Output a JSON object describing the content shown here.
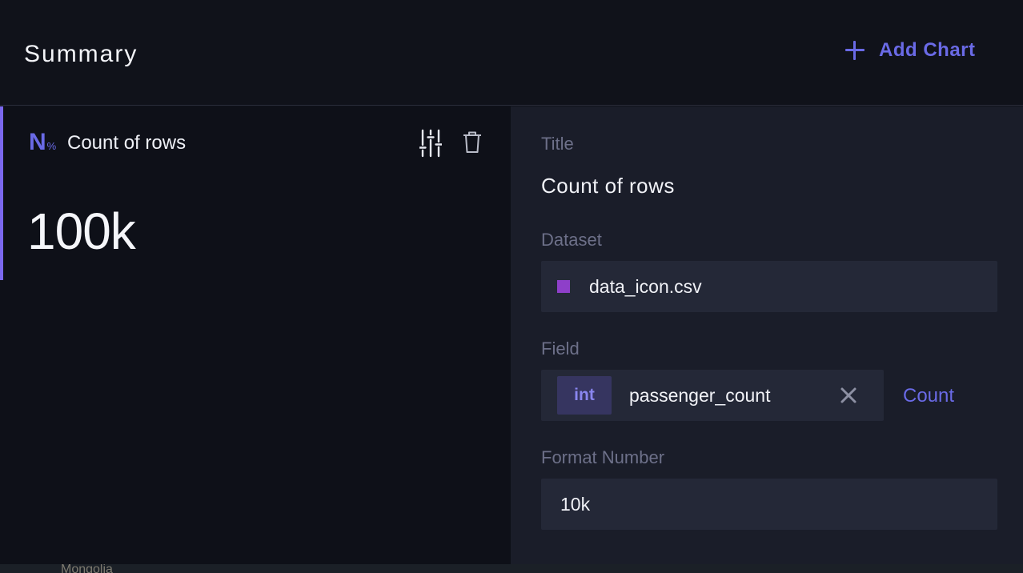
{
  "header": {
    "title": "Summary",
    "add_chart_label": "Add Chart",
    "add_chart_icon": "plus-icon"
  },
  "card": {
    "type_icon": {
      "letter": "N",
      "suffix": "%"
    },
    "title": "Count of rows",
    "value": "100k",
    "settings_icon": "sliders-icon",
    "delete_icon": "trash-icon",
    "accent_color": "#7b68ee"
  },
  "editor": {
    "title_label": "Title",
    "title_value": "Count of rows",
    "dataset_label": "Dataset",
    "dataset_name": "data_icon.csv",
    "dataset_color": "#8e3fc9",
    "field_label": "Field",
    "field_type": "int",
    "field_name": "passenger_count",
    "field_clear_icon": "close-icon",
    "aggregation": "Count",
    "format_label": "Format Number",
    "format_value": "10k"
  },
  "background": {
    "partial_text": "Mongolia"
  },
  "colors": {
    "accent": "#6a6ae6",
    "panel_bg": "#1a1d29",
    "input_bg": "#242837"
  }
}
